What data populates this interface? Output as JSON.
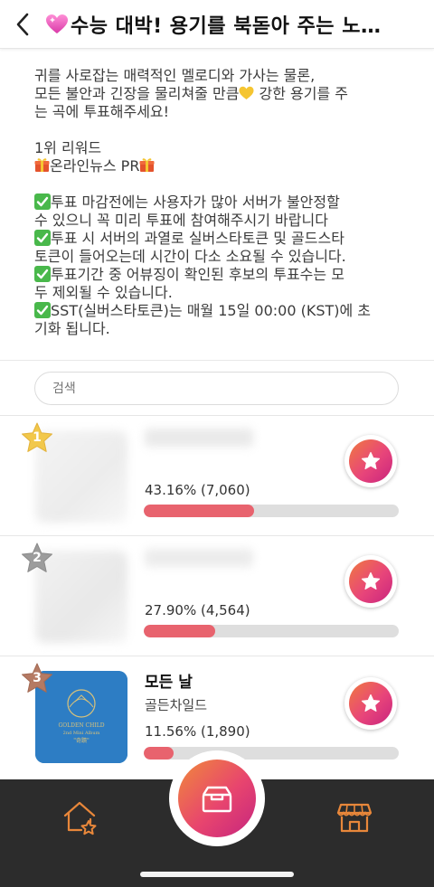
{
  "header": {
    "title": "수능 대박! 용기를 북돋아 주는 노…"
  },
  "description": {
    "line1": "귀를 사로잡는 매력적인 멜로디와 가사는 물론,",
    "line2a": "모든 불안과 긴장을 물리쳐줄 만큼",
    "line2b": " 강한 용기를 주",
    "line3": "는 곡에 투표해주세요!",
    "reward_title": "1위 리워드",
    "reward_item": "온라인뉴스 PR",
    "notices": [
      {
        "l1": "투표 마감전에는 사용자가 많아 서버가  불안정할",
        "l2": "수 있으니 꼭 미리 투표에 참여해주시기 바랍니다"
      },
      {
        "l1": "투표 시 서버의 과열로 실버스타토큰 및 골드스타",
        "l2": "토큰이 들어오는데 시간이 다소 소요될 수 있습니다."
      },
      {
        "l1": "투표기간 중 어뷰징이 확인된 후보의 투표수는 모",
        "l2": "두 제외될 수 있습니다."
      },
      {
        "l1": "SST(실버스타토큰)는 매월 15일 00:00 (KST)에 초",
        "l2": "기화 됩니다."
      }
    ]
  },
  "search": {
    "placeholder": "검색"
  },
  "candidates": [
    {
      "rank": "1",
      "song": "",
      "artist": "",
      "percent_text": "43.16% (7,060)",
      "percent": 43.16
    },
    {
      "rank": "2",
      "song": "",
      "artist": "",
      "percent_text": "27.90% (4,564)",
      "percent": 27.9
    },
    {
      "rank": "3",
      "song": "모든 날",
      "artist": "골든차일드",
      "percent_text": "11.56% (1,890)",
      "percent": 11.56,
      "album_text": {
        "line1": "GOLDEN CHILD",
        "line2": "2nd Mini Album",
        "line3": "\"奇蹟\""
      }
    }
  ],
  "colors": {
    "accent_red": "#e8636e",
    "gold_star": "#f2c84b",
    "silver_star": "#9c9c9c",
    "bronze_star": "#b57a63",
    "tab_icon": "#e8873a",
    "tabbar_bg": "#2c2c2c"
  },
  "icons": {
    "back": "chevron-left-icon",
    "title_emoji": "sparkling-heart-icon",
    "vote": "star-icon",
    "home": "home-star-icon",
    "center": "ballot-box-icon",
    "store": "store-icon"
  }
}
